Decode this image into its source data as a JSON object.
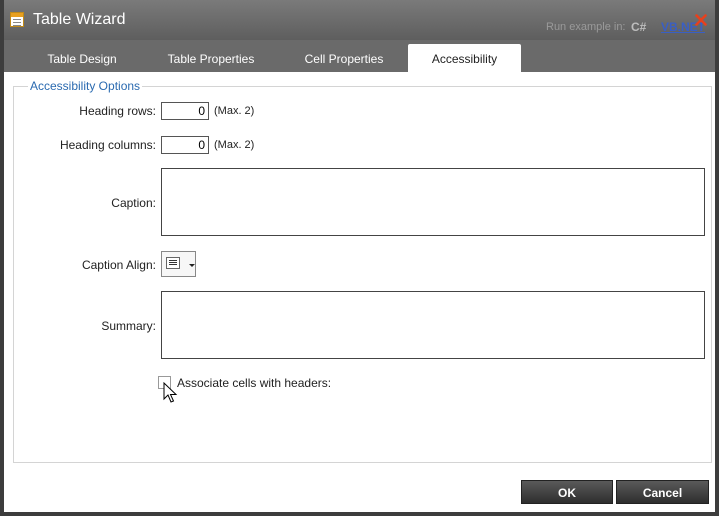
{
  "window": {
    "title": "Table Wizard",
    "close_icon": "close-icon"
  },
  "background": {
    "hint_text": "Run example in:",
    "lang_csharp": "C#",
    "lang_vbnet": "VB.NET"
  },
  "tabs": [
    {
      "label": "Table Design",
      "active": false
    },
    {
      "label": "Table Properties",
      "active": false
    },
    {
      "label": "Cell Properties",
      "active": false
    },
    {
      "label": "Accessibility",
      "active": true
    }
  ],
  "accessibility": {
    "legend": "Accessibility Options",
    "heading_rows": {
      "label": "Heading rows:",
      "value": "0",
      "max": "(Max. 2)"
    },
    "heading_columns": {
      "label": "Heading columns:",
      "value": "0",
      "max": "(Max. 2)"
    },
    "caption": {
      "label": "Caption:",
      "value": ""
    },
    "caption_align": {
      "label": "Caption Align:",
      "icon": "align-left-icon"
    },
    "summary": {
      "label": "Summary:",
      "value": ""
    },
    "associate_cells": {
      "label": "Associate cells with headers:",
      "checked": false
    }
  },
  "buttons": {
    "ok": "OK",
    "cancel": "Cancel"
  },
  "colors": {
    "titlebar": "#6a6a6a",
    "legend": "#2a6ab0",
    "close": "#e8401c",
    "accent_link": "#3a5fc4"
  }
}
